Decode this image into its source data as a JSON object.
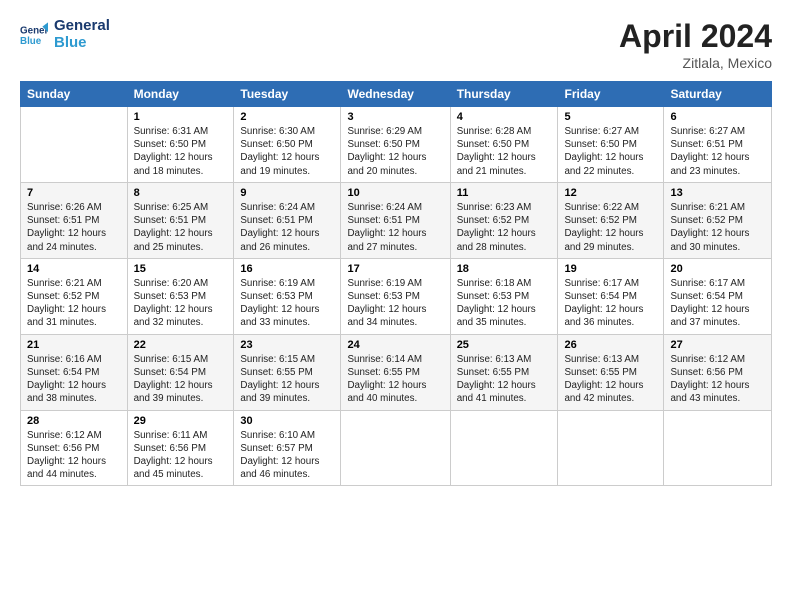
{
  "header": {
    "logo_line1": "General",
    "logo_line2": "Blue",
    "title": "April 2024",
    "subtitle": "Zitlala, Mexico"
  },
  "days_of_week": [
    "Sunday",
    "Monday",
    "Tuesday",
    "Wednesday",
    "Thursday",
    "Friday",
    "Saturday"
  ],
  "weeks": [
    [
      {
        "day": "",
        "content": ""
      },
      {
        "day": "1",
        "content": "Sunrise: 6:31 AM\nSunset: 6:50 PM\nDaylight: 12 hours\nand 18 minutes."
      },
      {
        "day": "2",
        "content": "Sunrise: 6:30 AM\nSunset: 6:50 PM\nDaylight: 12 hours\nand 19 minutes."
      },
      {
        "day": "3",
        "content": "Sunrise: 6:29 AM\nSunset: 6:50 PM\nDaylight: 12 hours\nand 20 minutes."
      },
      {
        "day": "4",
        "content": "Sunrise: 6:28 AM\nSunset: 6:50 PM\nDaylight: 12 hours\nand 21 minutes."
      },
      {
        "day": "5",
        "content": "Sunrise: 6:27 AM\nSunset: 6:50 PM\nDaylight: 12 hours\nand 22 minutes."
      },
      {
        "day": "6",
        "content": "Sunrise: 6:27 AM\nSunset: 6:51 PM\nDaylight: 12 hours\nand 23 minutes."
      }
    ],
    [
      {
        "day": "7",
        "content": "Sunrise: 6:26 AM\nSunset: 6:51 PM\nDaylight: 12 hours\nand 24 minutes."
      },
      {
        "day": "8",
        "content": "Sunrise: 6:25 AM\nSunset: 6:51 PM\nDaylight: 12 hours\nand 25 minutes."
      },
      {
        "day": "9",
        "content": "Sunrise: 6:24 AM\nSunset: 6:51 PM\nDaylight: 12 hours\nand 26 minutes."
      },
      {
        "day": "10",
        "content": "Sunrise: 6:24 AM\nSunset: 6:51 PM\nDaylight: 12 hours\nand 27 minutes."
      },
      {
        "day": "11",
        "content": "Sunrise: 6:23 AM\nSunset: 6:52 PM\nDaylight: 12 hours\nand 28 minutes."
      },
      {
        "day": "12",
        "content": "Sunrise: 6:22 AM\nSunset: 6:52 PM\nDaylight: 12 hours\nand 29 minutes."
      },
      {
        "day": "13",
        "content": "Sunrise: 6:21 AM\nSunset: 6:52 PM\nDaylight: 12 hours\nand 30 minutes."
      }
    ],
    [
      {
        "day": "14",
        "content": "Sunrise: 6:21 AM\nSunset: 6:52 PM\nDaylight: 12 hours\nand 31 minutes."
      },
      {
        "day": "15",
        "content": "Sunrise: 6:20 AM\nSunset: 6:53 PM\nDaylight: 12 hours\nand 32 minutes."
      },
      {
        "day": "16",
        "content": "Sunrise: 6:19 AM\nSunset: 6:53 PM\nDaylight: 12 hours\nand 33 minutes."
      },
      {
        "day": "17",
        "content": "Sunrise: 6:19 AM\nSunset: 6:53 PM\nDaylight: 12 hours\nand 34 minutes."
      },
      {
        "day": "18",
        "content": "Sunrise: 6:18 AM\nSunset: 6:53 PM\nDaylight: 12 hours\nand 35 minutes."
      },
      {
        "day": "19",
        "content": "Sunrise: 6:17 AM\nSunset: 6:54 PM\nDaylight: 12 hours\nand 36 minutes."
      },
      {
        "day": "20",
        "content": "Sunrise: 6:17 AM\nSunset: 6:54 PM\nDaylight: 12 hours\nand 37 minutes."
      }
    ],
    [
      {
        "day": "21",
        "content": "Sunrise: 6:16 AM\nSunset: 6:54 PM\nDaylight: 12 hours\nand 38 minutes."
      },
      {
        "day": "22",
        "content": "Sunrise: 6:15 AM\nSunset: 6:54 PM\nDaylight: 12 hours\nand 39 minutes."
      },
      {
        "day": "23",
        "content": "Sunrise: 6:15 AM\nSunset: 6:55 PM\nDaylight: 12 hours\nand 39 minutes."
      },
      {
        "day": "24",
        "content": "Sunrise: 6:14 AM\nSunset: 6:55 PM\nDaylight: 12 hours\nand 40 minutes."
      },
      {
        "day": "25",
        "content": "Sunrise: 6:13 AM\nSunset: 6:55 PM\nDaylight: 12 hours\nand 41 minutes."
      },
      {
        "day": "26",
        "content": "Sunrise: 6:13 AM\nSunset: 6:55 PM\nDaylight: 12 hours\nand 42 minutes."
      },
      {
        "day": "27",
        "content": "Sunrise: 6:12 AM\nSunset: 6:56 PM\nDaylight: 12 hours\nand 43 minutes."
      }
    ],
    [
      {
        "day": "28",
        "content": "Sunrise: 6:12 AM\nSunset: 6:56 PM\nDaylight: 12 hours\nand 44 minutes."
      },
      {
        "day": "29",
        "content": "Sunrise: 6:11 AM\nSunset: 6:56 PM\nDaylight: 12 hours\nand 45 minutes."
      },
      {
        "day": "30",
        "content": "Sunrise: 6:10 AM\nSunset: 6:57 PM\nDaylight: 12 hours\nand 46 minutes."
      },
      {
        "day": "",
        "content": ""
      },
      {
        "day": "",
        "content": ""
      },
      {
        "day": "",
        "content": ""
      },
      {
        "day": "",
        "content": ""
      }
    ]
  ]
}
